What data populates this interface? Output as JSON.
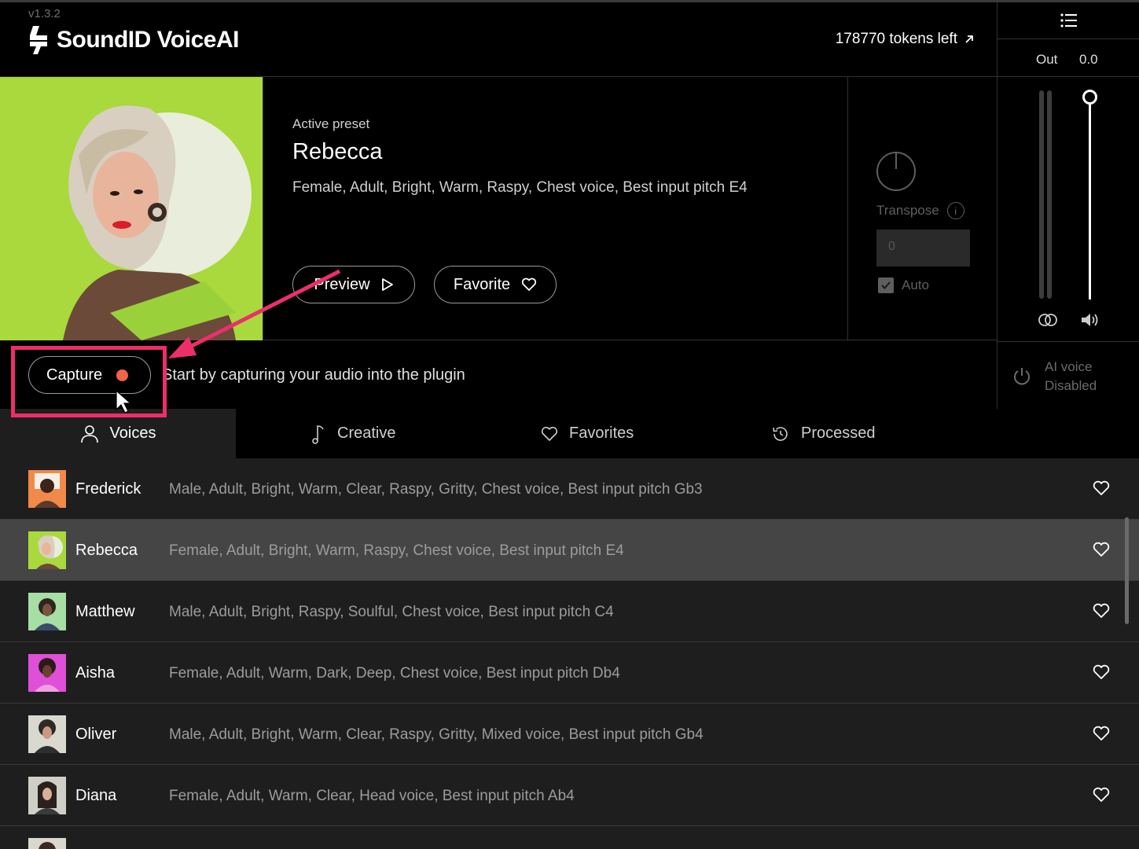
{
  "app": {
    "version": "v1.3.2",
    "title": "SoundID VoiceAI",
    "tokens": "178770 tokens left"
  },
  "output": {
    "label": "Out",
    "value": "0.0"
  },
  "ai_voice": {
    "line1": "AI voice",
    "line2": "Disabled"
  },
  "preset": {
    "active_label": "Active preset",
    "name": "Rebecca",
    "tags": "Female, Adult, Bright, Warm, Raspy, Chest voice, Best input pitch  E4",
    "preview_label": "Preview",
    "favorite_label": "Favorite"
  },
  "transpose": {
    "label": "Transpose",
    "value": "0",
    "auto_label": "Auto"
  },
  "capture": {
    "button_label": "Capture",
    "hint": "Start by capturing your audio into the plugin"
  },
  "tabs": [
    {
      "label": "Voices",
      "icon": "person-icon"
    },
    {
      "label": "Creative",
      "icon": "music-note-icon"
    },
    {
      "label": "Favorites",
      "icon": "heart-icon"
    },
    {
      "label": "Processed",
      "icon": "history-icon"
    }
  ],
  "voices": [
    {
      "name": "Frederick",
      "tags": "Male, Adult, Bright, Warm, Clear, Raspy, Gritty, Chest voice, Best input pitch  Gb3",
      "thumb_color": "#f0894a"
    },
    {
      "name": "Rebecca",
      "tags": "Female, Adult, Bright, Warm, Raspy, Chest voice, Best input pitch  E4",
      "thumb_color": "#a9d93c",
      "selected": true
    },
    {
      "name": "Matthew",
      "tags": "Male, Adult, Bright, Raspy, Soulful, Chest voice, Best input pitch  C4",
      "thumb_color": "#6fcf6f"
    },
    {
      "name": "Aisha",
      "tags": "Female, Adult, Warm, Dark, Deep, Chest voice, Best input pitch  Db4",
      "thumb_color": "#e04fd8"
    },
    {
      "name": "Oliver",
      "tags": "Male, Adult, Bright, Warm, Clear, Raspy, Gritty, Mixed voice, Best input pitch  Gb4",
      "thumb_color": "#d9d9cf"
    },
    {
      "name": "Diana",
      "tags": "Female, Adult, Warm, Clear, Head voice, Best input pitch  Ab4",
      "thumb_color": "#cfcfc8"
    },
    {
      "name": "",
      "tags": "",
      "thumb_color": "#d8d8cc"
    }
  ],
  "colors": {
    "accent": "#f1634a",
    "annotation": "#ec2f6a",
    "hero_bg": "#a9d93c"
  }
}
